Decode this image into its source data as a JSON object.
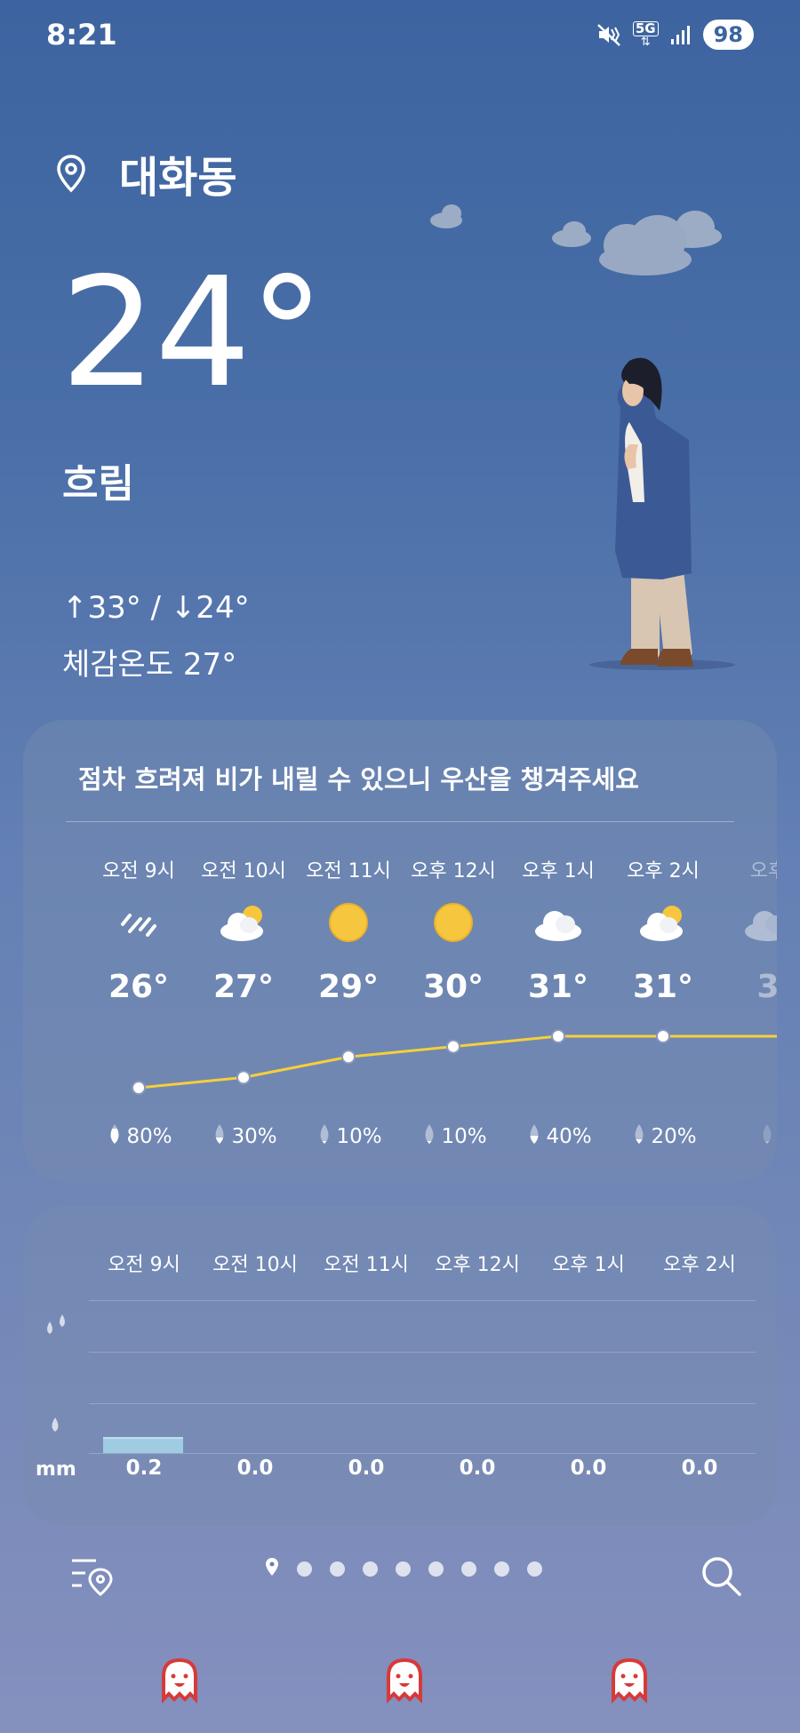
{
  "status": {
    "time": "8:21",
    "network": "5G",
    "battery": "98"
  },
  "location": {
    "name": "대화동"
  },
  "current": {
    "temperature": "24°",
    "condition": "흐림",
    "high_low": "↑33° / ↓24°",
    "feels_like": "체감온도 27°"
  },
  "hourly": {
    "message": "점차 흐려져 비가 내릴 수 있으니 우산을 챙겨주세요",
    "hours": [
      {
        "time": "오전 9시",
        "icon": "rain-icon",
        "temp": "26°",
        "temp_value": 26,
        "precip": "80%",
        "precip_level": 0.8
      },
      {
        "time": "오전 10시",
        "icon": "partly-cloudy-icon",
        "temp": "27°",
        "temp_value": 27,
        "precip": "30%",
        "precip_level": 0.3
      },
      {
        "time": "오전 11시",
        "icon": "sun-icon",
        "temp": "29°",
        "temp_value": 29,
        "precip": "10%",
        "precip_level": 0.1
      },
      {
        "time": "오후 12시",
        "icon": "sun-icon",
        "temp": "30°",
        "temp_value": 30,
        "precip": "10%",
        "precip_level": 0.1
      },
      {
        "time": "오후 1시",
        "icon": "cloud-icon",
        "temp": "31°",
        "temp_value": 31,
        "precip": "40%",
        "precip_level": 0.4
      },
      {
        "time": "오후 2시",
        "icon": "partly-cloudy-icon",
        "temp": "31°",
        "temp_value": 31,
        "precip": "20%",
        "precip_level": 0.2
      },
      {
        "time": "오후",
        "icon": "cloud-icon",
        "temp": "3",
        "temp_value": 31,
        "precip": "",
        "precip_level": 0.1
      }
    ]
  },
  "rainfall": {
    "unit": "mm",
    "hours": [
      {
        "time": "오전 9시",
        "amount": "0.2",
        "amount_value": 0.2
      },
      {
        "time": "오전 10시",
        "amount": "0.0",
        "amount_value": 0
      },
      {
        "time": "오전 11시",
        "amount": "0.0",
        "amount_value": 0
      },
      {
        "time": "오후 12시",
        "amount": "0.0",
        "amount_value": 0
      },
      {
        "time": "오후 1시",
        "amount": "0.0",
        "amount_value": 0
      },
      {
        "time": "오후 2시",
        "amount": "0.0",
        "amount_value": 0
      }
    ]
  },
  "pager": {
    "total_pages": 9,
    "current_page": 1
  },
  "colors": {
    "templine": "#f5cf3a",
    "sun": "#f7c63f",
    "rain_bar": "#a8d8ec"
  }
}
